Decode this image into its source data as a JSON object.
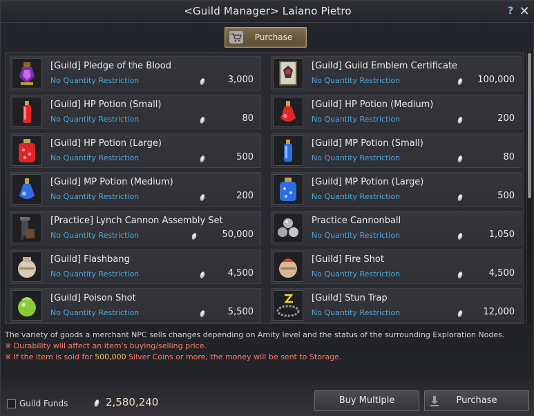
{
  "window": {
    "title": "<Guild Manager> Laiano Pietro",
    "help_label": "?",
    "close_label": "✕"
  },
  "tabs": {
    "purchase_label": "Purchase"
  },
  "items": [
    {
      "name": "[Guild] Pledge of the Blood",
      "restriction": "No Quantity Restriction",
      "price": "3,000",
      "icon": "pledge-of-blood-icon"
    },
    {
      "name": "[Guild] Guild Emblem Certificate",
      "restriction": "No Quantity Restriction",
      "price": "100,000",
      "icon": "emblem-certificate-icon"
    },
    {
      "name": "[Guild] HP Potion (Small)",
      "restriction": "No Quantity Restriction",
      "price": "80",
      "icon": "hp-potion-small-icon"
    },
    {
      "name": "[Guild] HP Potion (Medium)",
      "restriction": "No Quantity Restriction",
      "price": "200",
      "icon": "hp-potion-medium-icon"
    },
    {
      "name": "[Guild] HP Potion (Large)",
      "restriction": "No Quantity Restriction",
      "price": "500",
      "icon": "hp-potion-large-icon"
    },
    {
      "name": "[Guild] MP Potion (Small)",
      "restriction": "No Quantity Restriction",
      "price": "80",
      "icon": "mp-potion-small-icon"
    },
    {
      "name": "[Guild] MP Potion (Medium)",
      "restriction": "No Quantity Restriction",
      "price": "200",
      "icon": "mp-potion-medium-icon"
    },
    {
      "name": "[Guild] MP Potion (Large)",
      "restriction": "No Quantity Restriction",
      "price": "500",
      "icon": "mp-potion-large-icon"
    },
    {
      "name": "[Practice] Lynch Cannon Assembly Set",
      "restriction": "No Quantity Restriction",
      "price": "50,000",
      "icon": "cannon-assembly-icon"
    },
    {
      "name": "Practice Cannonball",
      "restriction": "No Quantity Restriction",
      "price": "1,050",
      "icon": "cannonball-icon"
    },
    {
      "name": "[Guild] Flashbang",
      "restriction": "No Quantity Restriction",
      "price": "4,500",
      "icon": "flashbang-icon"
    },
    {
      "name": "[Guild] Fire Shot",
      "restriction": "No Quantity Restriction",
      "price": "4,500",
      "icon": "fire-shot-icon"
    },
    {
      "name": "[Guild] Poison Shot",
      "restriction": "No Quantity Restriction",
      "price": "5,500",
      "icon": "poison-shot-icon"
    },
    {
      "name": "[Guild] Stun Trap",
      "restriction": "No Quantity Restriction",
      "price": "12,000",
      "icon": "stun-trap-icon"
    }
  ],
  "info": {
    "line1": "The variety of goods a merchant NPC sells changes depending on Amity level and the status of the surrounding Exploration Nodes.",
    "line2": "※ Durability will affect an item's buying/selling price.",
    "line3_pre": "※ If the item is sold for ",
    "line3_amount": "500,000",
    "line3_post": " Silver Coins or more, the money will be sent to Storage."
  },
  "footer": {
    "guild_funds_label": "Guild Funds",
    "guild_funds_value": "2,580,240",
    "buy_multiple_label": "Buy Multiple",
    "purchase_label": "Purchase"
  },
  "colors": {
    "accent_blue": "#49a8e0",
    "warning_red": "#ff7a6b",
    "highlight_gold": "#f2c44d"
  }
}
